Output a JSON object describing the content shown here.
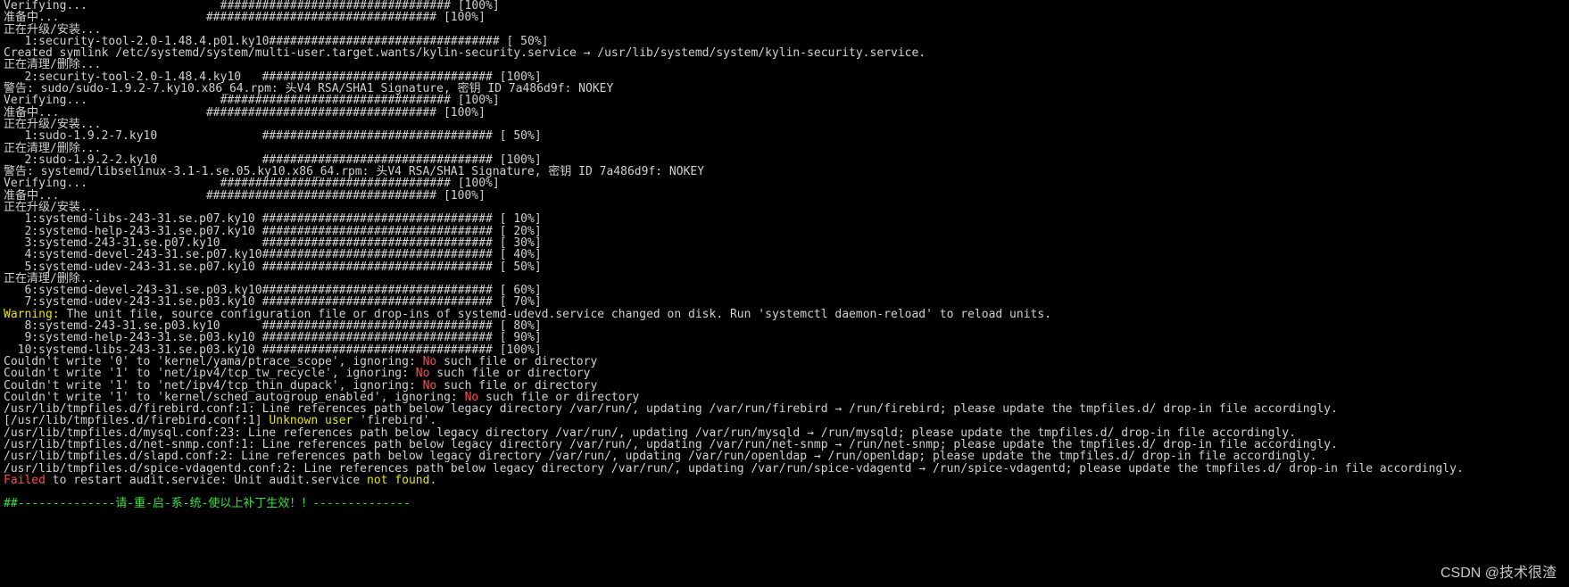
{
  "lines": [
    {
      "segs": [
        {
          "t": "Verifying...                   ################################# [100%]"
        }
      ]
    },
    {
      "segs": [
        {
          "t": "准备中...                     ################################# [100%]"
        }
      ]
    },
    {
      "segs": [
        {
          "t": "正在升级/安装..."
        }
      ]
    },
    {
      "segs": [
        {
          "t": "   1:security-tool-2.0-1.48.4.p01.ky10################################# [ 50%]"
        }
      ]
    },
    {
      "segs": [
        {
          "t": "Created symlink /etc/systemd/system/multi-user.target.wants/kylin-security.service → /usr/lib/systemd/system/kylin-security.service."
        }
      ]
    },
    {
      "segs": [
        {
          "t": "正在清理/删除..."
        }
      ]
    },
    {
      "segs": [
        {
          "t": "   2:security-tool-2.0-1.48.4.ky10   ################################# [100%]"
        }
      ]
    },
    {
      "segs": [
        {
          "t": "警告: sudo/sudo-1.9.2-7.ky10.x86_64.rpm: 头V4 RSA/SHA1 Signature, 密钥 ID 7a486d9f: NOKEY"
        }
      ]
    },
    {
      "segs": [
        {
          "t": "Verifying...                   ################################# [100%]"
        }
      ]
    },
    {
      "segs": [
        {
          "t": "准备中...                     ################################# [100%]"
        }
      ]
    },
    {
      "segs": [
        {
          "t": "正在升级/安装..."
        }
      ]
    },
    {
      "segs": [
        {
          "t": "   1:sudo-1.9.2-7.ky10               ################################# [ 50%]"
        }
      ]
    },
    {
      "segs": [
        {
          "t": "正在清理/删除..."
        }
      ]
    },
    {
      "segs": [
        {
          "t": "   2:sudo-1.9.2-2.ky10               ################################# [100%]"
        }
      ]
    },
    {
      "segs": [
        {
          "t": "警告: systemd/libselinux-3.1-1.se.05.ky10.x86_64.rpm: 头V4 RSA/SHA1 Signature, 密钥 ID 7a486d9f: NOKEY"
        }
      ]
    },
    {
      "segs": [
        {
          "t": "Verifying...                   ################################# [100%]"
        }
      ]
    },
    {
      "segs": [
        {
          "t": "准备中...                     ################################# [100%]"
        }
      ]
    },
    {
      "segs": [
        {
          "t": "正在升级/安装..."
        }
      ]
    },
    {
      "segs": [
        {
          "t": "   1:systemd-libs-243-31.se.p07.ky10 ################################# [ 10%]"
        }
      ]
    },
    {
      "segs": [
        {
          "t": "   2:systemd-help-243-31.se.p07.ky10 ################################# [ 20%]"
        }
      ]
    },
    {
      "segs": [
        {
          "t": "   3:systemd-243-31.se.p07.ky10      ################################# [ 30%]"
        }
      ]
    },
    {
      "segs": [
        {
          "t": "   4:systemd-devel-243-31.se.p07.ky10################################# [ 40%]"
        }
      ]
    },
    {
      "segs": [
        {
          "t": "   5:systemd-udev-243-31.se.p07.ky10 ################################# [ 50%]"
        }
      ]
    },
    {
      "segs": [
        {
          "t": "正在清理/删除..."
        }
      ]
    },
    {
      "segs": [
        {
          "t": "   6:systemd-devel-243-31.se.p03.ky10################################# [ 60%]"
        }
      ]
    },
    {
      "segs": [
        {
          "t": "   7:systemd-udev-243-31.se.p03.ky10 ################################# [ 70%]"
        }
      ]
    },
    {
      "segs": [
        {
          "c": "y",
          "t": "Warning:"
        },
        {
          "t": " The unit file, source configuration file or drop-ins of systemd-udevd.service changed on disk. Run 'systemctl daemon-reload' to reload units."
        }
      ]
    },
    {
      "segs": [
        {
          "t": "   8:systemd-243-31.se.p03.ky10      ################################# [ 80%]"
        }
      ]
    },
    {
      "segs": [
        {
          "t": "   9:systemd-help-243-31.se.p03.ky10 ################################# [ 90%]"
        }
      ]
    },
    {
      "segs": [
        {
          "t": "  10:systemd-libs-243-31.se.p03.ky10 ################################# [100%]"
        }
      ]
    },
    {
      "segs": [
        {
          "t": "Couldn't write '0' to 'kernel/yama/ptrace_scope', ignoring: "
        },
        {
          "c": "r",
          "t": "No"
        },
        {
          "t": " such file or directory"
        }
      ]
    },
    {
      "segs": [
        {
          "t": "Couldn't write '1' to 'net/ipv4/tcp_tw_recycle', ignoring: "
        },
        {
          "c": "r",
          "t": "No"
        },
        {
          "t": " such file or directory"
        }
      ]
    },
    {
      "segs": [
        {
          "t": "Couldn't write '1' to 'net/ipv4/tcp_thin_dupack', ignoring: "
        },
        {
          "c": "r",
          "t": "No"
        },
        {
          "t": " such file or directory"
        }
      ]
    },
    {
      "segs": [
        {
          "t": "Couldn't write '1' to 'kernel/sched_autogroup_enabled', ignoring: "
        },
        {
          "c": "r",
          "t": "No"
        },
        {
          "t": " such file or directory"
        }
      ]
    },
    {
      "segs": [
        {
          "t": "/usr/lib/tmpfiles.d/firebird.conf:1: Line references path below legacy directory /var/run/, updating /var/run/firebird → /run/firebird; please update the tmpfiles.d/ drop-in file accordingly."
        }
      ]
    },
    {
      "segs": [
        {
          "t": "[/usr/lib/tmpfiles.d/firebird.conf:1] "
        },
        {
          "c": "y",
          "t": "Unknown user"
        },
        {
          "t": " 'firebird'."
        }
      ]
    },
    {
      "segs": [
        {
          "t": "/usr/lib/tmpfiles.d/mysql.conf:23: Line references path below legacy directory /var/run/, updating /var/run/mysqld → /run/mysqld; please update the tmpfiles.d/ drop-in file accordingly."
        }
      ]
    },
    {
      "segs": [
        {
          "t": "/usr/lib/tmpfiles.d/net-snmp.conf:1: Line references path below legacy directory /var/run/, updating /var/run/net-snmp → /run/net-snmp; please update the tmpfiles.d/ drop-in file accordingly."
        }
      ]
    },
    {
      "segs": [
        {
          "t": "/usr/lib/tmpfiles.d/slapd.conf:2: Line references path below legacy directory /var/run/, updating /var/run/openldap → /run/openldap; please update the tmpfiles.d/ drop-in file accordingly."
        }
      ]
    },
    {
      "segs": [
        {
          "t": "/usr/lib/tmpfiles.d/spice-vdagentd.conf:2: Line references path below legacy directory /var/run/, updating /var/run/spice-vdagentd → /run/spice-vdagentd; please update the tmpfiles.d/ drop-in file accordingly."
        }
      ]
    },
    {
      "segs": [
        {
          "c": "r",
          "t": "Failed"
        },
        {
          "t": " to restart audit.service: Unit audit.service "
        },
        {
          "c": "y",
          "t": "not found"
        },
        {
          "t": "."
        }
      ]
    },
    {
      "segs": [
        {
          "t": " "
        }
      ]
    },
    {
      "segs": [
        {
          "c": "g",
          "t": "##--------------请-重-启-系-统-使以上补丁生效！！--------------"
        }
      ]
    }
  ],
  "watermark": "CSDN @技术很渣"
}
